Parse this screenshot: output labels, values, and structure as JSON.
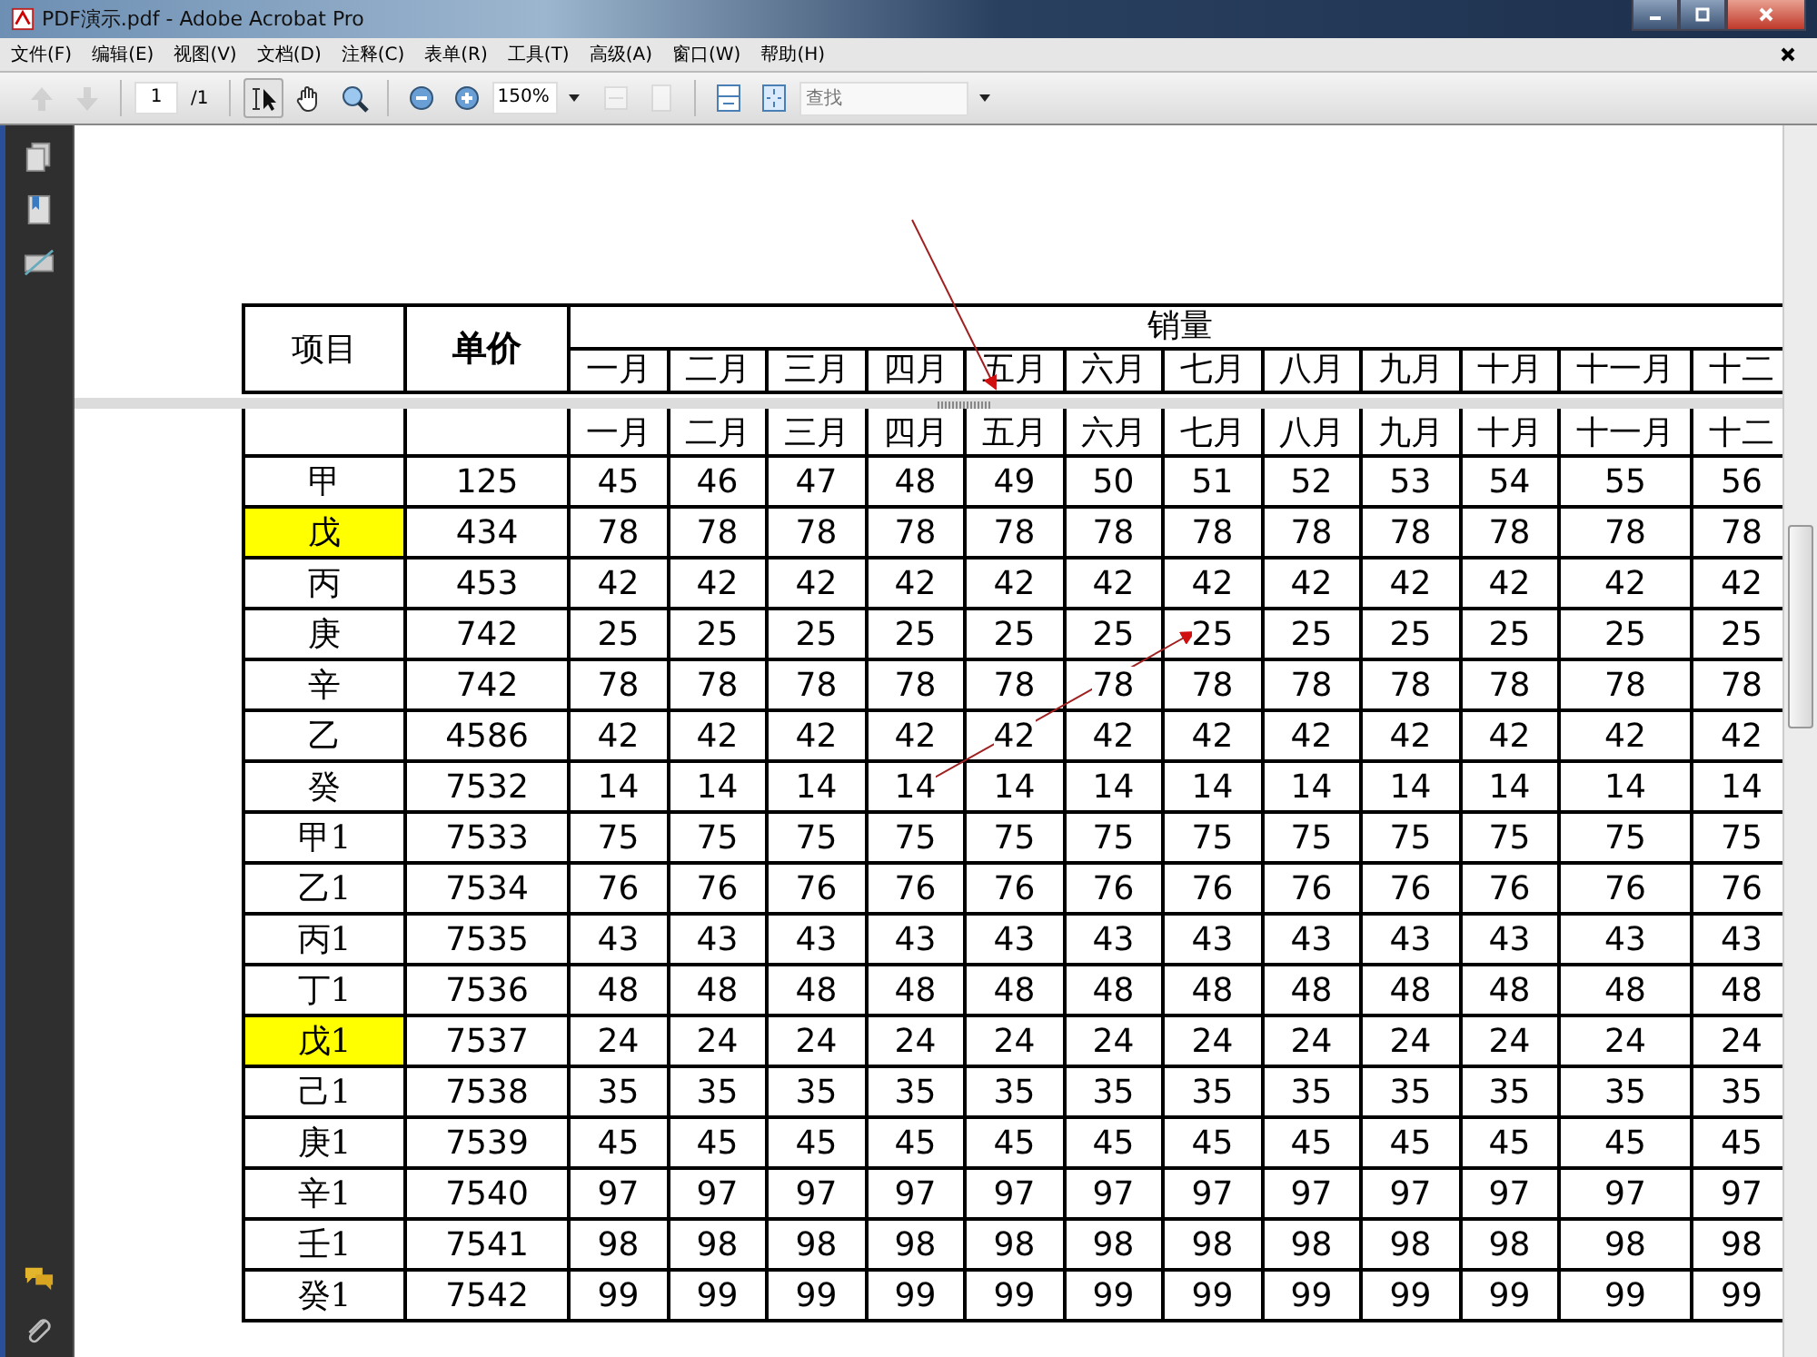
{
  "window": {
    "title": "PDF演示.pdf - Adobe Acrobat Pro"
  },
  "menu": [
    "文件(F)",
    "编辑(E)",
    "视图(V)",
    "文档(D)",
    "注释(C)",
    "表单(R)",
    "工具(T)",
    "高级(A)",
    "窗口(W)",
    "帮助(H)"
  ],
  "toolbar": {
    "page": "1",
    "page_total": "/1",
    "zoom": "150%",
    "search": {
      "placeholder": "查找"
    },
    "tools": [
      {
        "kind": "prev",
        "disabled": true
      },
      {
        "kind": "next",
        "disabled": true
      },
      {
        "kind": "page"
      },
      {
        "kind": "select",
        "selected": true
      },
      {
        "kind": "hand",
        "selected": false
      },
      {
        "kind": "marquee",
        "selected": false
      },
      {
        "kind": "zoom-out"
      },
      {
        "kind": "zoom-in"
      },
      {
        "kind": "zoom"
      },
      {
        "kind": "fit-width",
        "disabled": true
      },
      {
        "kind": "fit-page",
        "disabled": true
      },
      {
        "kind": "scroll"
      },
      {
        "kind": "full"
      },
      {
        "kind": "search"
      }
    ]
  },
  "table": {
    "columns": [
      "项目",
      "单价"
    ],
    "group_header": "销量",
    "months": [
      "一月",
      "二月",
      "三月",
      "四月",
      "五月",
      "六月",
      "七月",
      "八月",
      "九月",
      "十月",
      "十一月",
      "十二"
    ],
    "split_months": [
      "一月",
      "二月",
      "三月",
      "四月",
      "五月",
      "六月",
      "七月",
      "八月",
      "九月",
      "十月",
      "十一月",
      "十二"
    ],
    "rows": [
      {
        "item": "甲",
        "price": "125",
        "values": [
          "45",
          "46",
          "47",
          "48",
          "49",
          "50",
          "51",
          "52",
          "53",
          "54",
          "55",
          "56"
        ],
        "highlighted": false
      },
      {
        "item": "戊",
        "price": "434",
        "values": [
          "78",
          "78",
          "78",
          "78",
          "78",
          "78",
          "78",
          "78",
          "78",
          "78",
          "78",
          "78"
        ],
        "highlighted": true
      },
      {
        "item": "丙",
        "price": "453",
        "values": [
          "42",
          "42",
          "42",
          "42",
          "42",
          "42",
          "42",
          "42",
          "42",
          "42",
          "42",
          "42"
        ],
        "highlighted": false
      },
      {
        "item": "庚",
        "price": "742",
        "values": [
          "25",
          "25",
          "25",
          "25",
          "25",
          "25",
          "25",
          "25",
          "25",
          "25",
          "25",
          "25"
        ],
        "highlighted": false
      },
      {
        "item": "辛",
        "price": "742",
        "values": [
          "78",
          "78",
          "78",
          "78",
          "78",
          "78",
          "78",
          "78",
          "78",
          "78",
          "78",
          "78"
        ],
        "highlighted": false
      },
      {
        "item": "乙",
        "price": "4586",
        "values": [
          "42",
          "42",
          "42",
          "42",
          "42",
          "42",
          "42",
          "42",
          "42",
          "42",
          "42",
          "42"
        ],
        "highlighted": false
      },
      {
        "item": "癸",
        "price": "7532",
        "values": [
          "14",
          "14",
          "14",
          "14",
          "14",
          "14",
          "14",
          "14",
          "14",
          "14",
          "14",
          "14"
        ],
        "highlighted": false
      },
      {
        "item": "甲1",
        "price": "7533",
        "values": [
          "75",
          "75",
          "75",
          "75",
          "75",
          "75",
          "75",
          "75",
          "75",
          "75",
          "75",
          "75"
        ],
        "highlighted": false
      },
      {
        "item": "乙1",
        "price": "7534",
        "values": [
          "76",
          "76",
          "76",
          "76",
          "76",
          "76",
          "76",
          "76",
          "76",
          "76",
          "76",
          "76"
        ],
        "highlighted": false
      },
      {
        "item": "丙1",
        "price": "7535",
        "values": [
          "43",
          "43",
          "43",
          "43",
          "43",
          "43",
          "43",
          "43",
          "43",
          "43",
          "43",
          "43"
        ],
        "highlighted": false
      },
      {
        "item": "丁1",
        "price": "7536",
        "values": [
          "48",
          "48",
          "48",
          "48",
          "48",
          "48",
          "48",
          "48",
          "48",
          "48",
          "48",
          "48"
        ],
        "highlighted": false
      },
      {
        "item": "戊1",
        "price": "7537",
        "values": [
          "24",
          "24",
          "24",
          "24",
          "24",
          "24",
          "24",
          "24",
          "24",
          "24",
          "24",
          "24"
        ],
        "highlighted": true
      },
      {
        "item": "己1",
        "price": "7538",
        "values": [
          "35",
          "35",
          "35",
          "35",
          "35",
          "35",
          "35",
          "35",
          "35",
          "35",
          "35",
          "35"
        ],
        "highlighted": false
      },
      {
        "item": "庚1",
        "price": "7539",
        "values": [
          "45",
          "45",
          "45",
          "45",
          "45",
          "45",
          "45",
          "45",
          "45",
          "45",
          "45",
          "45"
        ],
        "highlighted": false
      },
      {
        "item": "辛1",
        "price": "7540",
        "values": [
          "97",
          "97",
          "97",
          "97",
          "97",
          "97",
          "97",
          "97",
          "97",
          "97",
          "97",
          "97"
        ],
        "highlighted": false
      },
      {
        "item": "壬1",
        "price": "7541",
        "values": [
          "98",
          "98",
          "98",
          "98",
          "98",
          "98",
          "98",
          "98",
          "98",
          "98",
          "98",
          "98"
        ],
        "highlighted": false
      },
      {
        "item": "癸1",
        "price": "7542",
        "values": [
          "99",
          "99",
          "99",
          "99",
          "99",
          "99",
          "99",
          "99",
          "99",
          "99",
          "99",
          "99"
        ],
        "highlighted": false
      }
    ]
  }
}
